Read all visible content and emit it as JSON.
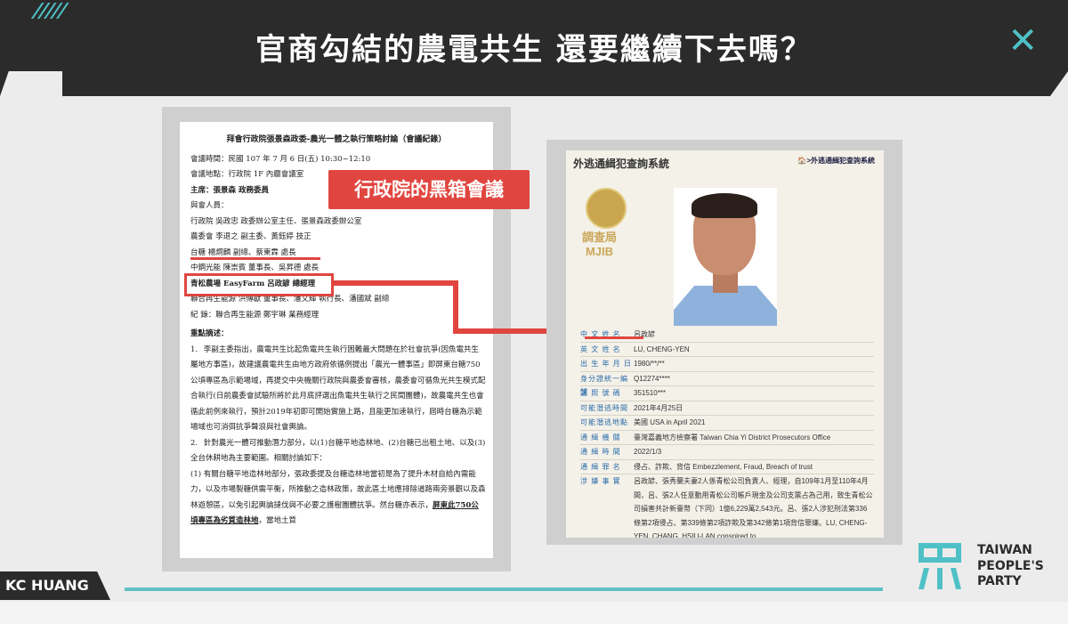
{
  "header": {
    "title": "官商勾結的農電共生  還要繼續下去嗎？",
    "close_glyph": "✕",
    "stripes": "/////"
  },
  "badge": {
    "label": "行政院的黑箱會議"
  },
  "doc": {
    "heading": "拜會行政院張景森政委-農光一體之執行策略討論（會議紀錄）",
    "lines": [
      "會議時間：民國 107 年 7 月 6 日(五) 10:30~12:10",
      "會議地點：行政院 1F 內廳會議室",
      "主席：張景森 政務委員",
      "與會人員：",
      "行政院  吳政忠 政委辦公室主任、張景森政委辦公室",
      "農委會  李退之 副主委、黃鈺婷 技正",
      "台糖    楊炯麟 副總、蔡東霖 處長",
      "中鋼光能  陳崇賓 董事長、吳昇德 處長",
      "青松農場 EasyFarm   呂政諺 總經理",
      "聯合再生能源  洪傳獻 董事長、潘文輝 執行長、潘國斌 副總",
      "紀  錄：聯合再生能源 鄭宇琳 業務經理"
    ],
    "section": "重點摘述：",
    "items": [
      {
        "num": "1.",
        "text": "李副主委指出，農電共生比起魚電共生執行困難最大問題在於社會抗爭(因魚電共生屬地方事區)，故建議農電共生由地方政府依循例提出「農光一體事區」即屏東台糖750公頃專區為示範場域，再提交中央機關行政院與農委會審核，農委會可循魚光共生模式配合執行(日前農委會試驗所將於此月底評選出魚電共生執行之民間團體)，故農電共生也會循此前例來執行，預計2019年初即可開始實施上路，且能更加速執行，屆時台糖為示範場域也可消弭抗爭聲浪與社會輿論。"
      },
      {
        "num": "2.",
        "text": "針對農光一體可推動潛力部分，以(1)台糖平地造林地、(2)台糖已出租土地、以及(3)全台休耕地為主要範圍。相關討論如下："
      },
      {
        "num": "(1)",
        "text": "有關台糖平地造林地部分，張政委提及台糖造林地當初是為了提升木材自給內需能力，以及市場製糖供需平衡，所推動之造林政策，故此區土地應排除道路兩旁景觀以及森林遊憩區，以免引起輿論撻伐與不必要之護樹團體抗爭。然台糖亦表示，",
        "underline": "屏東此750公頃專區為劣質造林地",
        "tail": "，當地土質"
      }
    ]
  },
  "mjib": {
    "system_title": "外逃通緝犯查詢系統",
    "breadcrumb": "🏠>外逃通緝犯查詢系統",
    "seal_text": "調查局\nMJIB",
    "rows": [
      {
        "k": "中 文 姓 名",
        "v": "呂政諺"
      },
      {
        "k": "英 文 姓 名",
        "v": "LU, CHENG-YEN"
      },
      {
        "k": "出 生 年 月 日",
        "v": "1980/**/**"
      },
      {
        "k": "身分證統一編號",
        "v": "Q12274****"
      },
      {
        "k": "護 照 號 碼",
        "v": "351510***"
      },
      {
        "k": "可能潛逃時間",
        "v": "2021年4月25日"
      },
      {
        "k": "可能潛逃地點",
        "v": "美國 USA in April 2021"
      },
      {
        "k": "通 緝 機 關",
        "v": "臺灣嘉義地方檢察署 Taiwan Chia Yi District Prosecutors Office"
      },
      {
        "k": "通 緝 時 間",
        "v": "2022/1/3"
      },
      {
        "k": "通 緝 罪 名",
        "v": "侵占、詐欺、背信 Embezzlement, Fraud, Breach of trust"
      },
      {
        "k": "涉 嫌 事 實",
        "v": "呂政諺、張秀蘭夫妻2人係青松公司負責人、經理，自109年1月至110年4月間，呂、張2人任意動用青松公司帳戶現金及公司支票占為己用，致生青松公司損害共計新臺幣（下同）1億6,229萬2,543元。呂、張2人涉犯刑法第336條第2項侵占、第339條第2項詐欺及第342條第1項背信罪嫌。LU, CHENG-YEN, CHANG, HSIU-LAN conspired to"
      }
    ]
  },
  "footer": {
    "speaker": "KC HUANG",
    "party_line1": "TAIWAN",
    "party_line2": "PEOPLE'S",
    "party_line3": "PARTY"
  },
  "colors": {
    "dark": "#2b2b2b",
    "teal": "#4fc1c6",
    "red": "#e0463f"
  }
}
